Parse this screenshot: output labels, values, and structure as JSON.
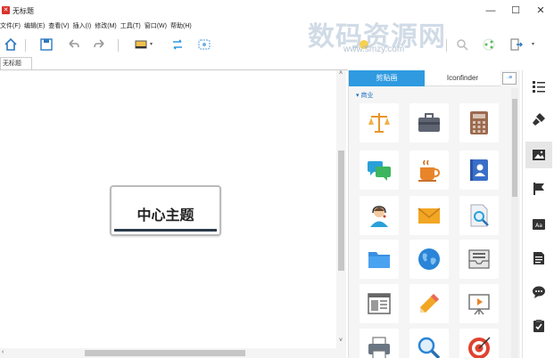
{
  "window": {
    "title": "无标题",
    "app_icon": "x-logo",
    "controls": [
      "—",
      "☐",
      "✕"
    ]
  },
  "menu": [
    "文件(F)",
    "编辑(E)",
    "查看(V)",
    "插入(I)",
    "修改(M)",
    "工具(T)",
    "窗口(W)",
    "帮助(H)"
  ],
  "toolbar": {
    "icons": [
      "home-icon",
      "save-icon",
      "undo-icon",
      "redo-icon",
      "topic-icon",
      "relationship-icon",
      "boundary-icon",
      "marker-icon",
      "search-icon",
      "share-icon",
      "export-icon"
    ]
  },
  "watermark": {
    "text": "数码资源网",
    "url": "www.smzy.com"
  },
  "document": {
    "tab_label": "无标题",
    "central_topic": "中心主题"
  },
  "panel": {
    "tabs": [
      "剪贴画",
      "Iconfinder"
    ],
    "active_tab": "剪贴画",
    "menu_glyph": "·≡",
    "category": "商业",
    "icons": [
      "scales-icon",
      "briefcase-icon",
      "calculator-icon",
      "chat-icon",
      "coffee-icon",
      "contacts-book-icon",
      "customer-service-icon",
      "mail-icon",
      "document-search-icon",
      "folder-icon",
      "globe-icon",
      "inbox-icon",
      "layout-icon",
      "pencil-icon",
      "presentation-icon",
      "printer-icon",
      "magnifier-icon",
      "target-icon"
    ]
  },
  "sidebar": {
    "items": [
      "outline-icon",
      "format-icon",
      "image-icon",
      "flag-icon",
      "label-icon",
      "notes-icon",
      "comment-icon",
      "task-icon"
    ],
    "active": "image-icon"
  },
  "colors": {
    "accent": "#2f9ae0",
    "topic_border": "#2b3a4a",
    "logo_red": "#d9322b"
  }
}
